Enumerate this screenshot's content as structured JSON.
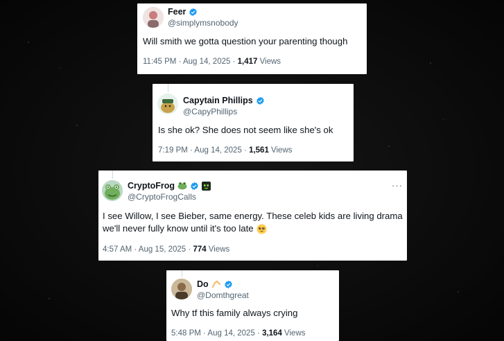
{
  "tweets": [
    {
      "name": "Feer",
      "handle": "@simplymsnobody",
      "text": "Will smith we gotta question your parenting though",
      "time": "11:45 PM · Aug 14, 2025 · ",
      "views_count": "1,417",
      "views_label": " Views"
    },
    {
      "name": "Capytain Phillips",
      "handle": "@CapyPhillips",
      "text": "Is she ok? She does not seem like she's ok",
      "time": "7:19 PM · Aug 14, 2025 · ",
      "views_count": "1,561",
      "views_label": " Views"
    },
    {
      "name": "CryptoFrog",
      "handle": "@CryptoFrogCalls",
      "text_line1": "I see Willow, I see Bieber, same energy. These celeb kids are living drama",
      "text_line2": "we'll never fully know until it's too late",
      "time": "4:57 AM · Aug 15, 2025 · ",
      "views_count": "774",
      "views_label": " Views",
      "more": "···"
    },
    {
      "name": "Do",
      "handle": "@Domthgreat",
      "text": "Why tf this family always crying",
      "time": "5:48 PM · Aug 14, 2025 · ",
      "views_count": "3,164",
      "views_label": " Views"
    }
  ],
  "colors": {
    "verified": "#1d9bf0",
    "background": "#0b0b0b",
    "secondary_text": "#536471"
  },
  "icons": [
    "verified-badge-icon",
    "frog-emoji-icon",
    "alien-square-icon",
    "pleading-face-emoji-icon",
    "flexed-arm-emoji-icon",
    "more-options-icon"
  ]
}
